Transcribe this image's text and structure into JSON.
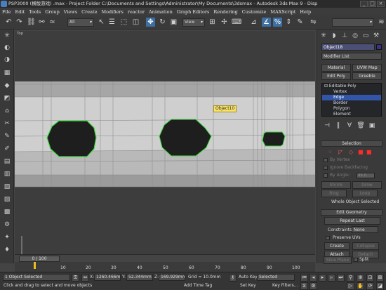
{
  "titlebar": {
    "text": "PSP3000 (横版游戏) .max   - Project Folder  C:\\Documents and Settings\\Administrator\\My Documents\\3dsmax    - Autodesk 3ds Max 9   - Disp"
  },
  "menu": [
    "File",
    "Edit",
    "Tools",
    "Group",
    "Views",
    "Create",
    "Modifiers",
    "reactor",
    "Animation",
    "Graph Editors",
    "Rendering",
    "Customize",
    "MAXScript",
    "Help"
  ],
  "toolbar": {
    "selection_filter": "All",
    "ref_coord": "View"
  },
  "viewport": {
    "label": "Top",
    "object_tooltip": "Object10"
  },
  "command_panel": {
    "object_name": "Object18",
    "modifier_list": "Modifier List",
    "buttons": {
      "material": "Material",
      "uvw_map": "UVW Map",
      "edit_poly": "Edit Poly",
      "greeble": "Greeble"
    },
    "stack": [
      {
        "label": "⊟ Editable Poly",
        "selected": false
      },
      {
        "label": "Vertex",
        "selected": false
      },
      {
        "label": "Edge",
        "selected": true
      },
      {
        "label": "Border",
        "selected": false
      },
      {
        "label": "Polygon",
        "selected": false
      },
      {
        "label": "Element",
        "selected": false
      }
    ],
    "selection_rollout": {
      "title": "Selection",
      "by_vertex": "By Vertex",
      "ignore_backfacing": "Ignore Backfacing",
      "by_angle": "By Angle:",
      "angle_value": "45.0",
      "shrink": "Shrink",
      "grow": "Grow",
      "ring": "Ring",
      "loop": "Loop",
      "status": "Whole Object Selected"
    },
    "edit_geometry": {
      "title": "Edit Geometry",
      "repeat_last": "Repeat Last",
      "constraints_label": "Constraints:",
      "constraints_value": "None",
      "preserve_uvs": "Preserve UVs",
      "create": "Create",
      "collapse": "Collapse",
      "attach": "Attach",
      "detach": "Detach",
      "slice_plane": "Slice Plane",
      "split": "Split"
    }
  },
  "timeline": {
    "frame": "0 / 100",
    "ticks": [
      "10",
      "20",
      "30",
      "40",
      "50",
      "60",
      "70",
      "80",
      "90",
      "100"
    ]
  },
  "status": {
    "selected": "1 Object Selected",
    "prompt": "Click and drag to select and move objects",
    "x_label": "X:",
    "x_value": "1260.466m",
    "y_label": "Y:",
    "y_value": "52.344mm",
    "z_label": "Z:",
    "z_value": "169.929mm",
    "grid": "Grid = 10.0mm",
    "add_time_tag": "Add Time Tag",
    "auto_key": "Auto Key",
    "set_key": "Set Key",
    "selected_filter": "Selected",
    "key_filters": "Key Filters..."
  },
  "colors": {
    "selection_blue": "#3d6fa3",
    "object_color": "#3b2f8f",
    "tooltip_yellow": "#f7e26b",
    "edge_green": "#3ddc3d"
  }
}
